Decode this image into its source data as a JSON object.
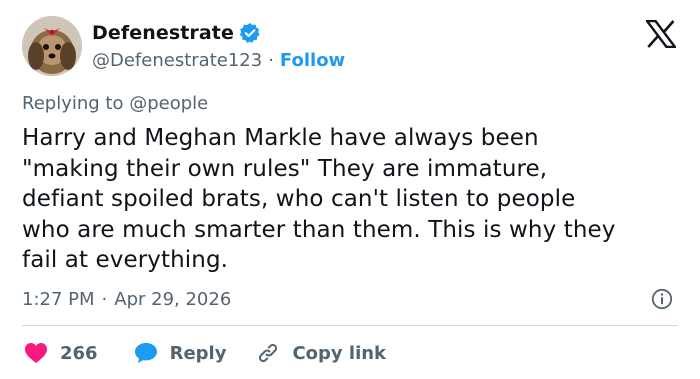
{
  "author": {
    "display_name": "Defenestrate",
    "handle": "@Defenestrate123",
    "separator": "·",
    "follow_label": "Follow",
    "verified_color": "#1d9bf0"
  },
  "reply_context": "Replying to @people",
  "tweet": {
    "text": "Harry and Meghan Markle have always been\n\"making their own rules\" They are immature,\ndefiant spoiled brats, who can't listen to people\nwho are much smarter than them. This is why they\nfail at everything.",
    "time": "1:27 PM",
    "date": "Apr 29, 2026",
    "separator": "·"
  },
  "actions": {
    "like_count": "266",
    "reply_label": "Reply",
    "copy_label": "Copy link"
  },
  "colors": {
    "accent": "#1d9bf0",
    "like": "#f91880",
    "muted_text": "#536471",
    "text": "#0f1419",
    "divider": "#cfd9de"
  },
  "icons": {
    "brand": "x-logo-icon",
    "verified": "verified-badge-icon",
    "info": "info-icon",
    "like": "heart-icon",
    "reply": "speech-bubble-icon",
    "copy": "link-icon"
  }
}
